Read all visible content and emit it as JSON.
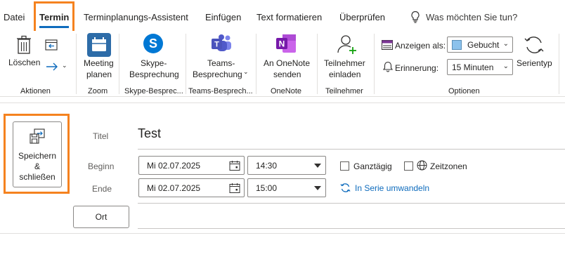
{
  "tabs": {
    "items": [
      "Datei",
      "Termin",
      "Terminplanungs-Assistent",
      "Einfügen",
      "Text formatieren",
      "Überprüfen"
    ],
    "search_placeholder": "Was möchten Sie tun?"
  },
  "ribbon": {
    "loeschen": "Löschen",
    "meeting_1": "Meeting",
    "meeting_2": "planen",
    "skype_1": "Skype-",
    "skype_2": "Besprechung",
    "teams_1": "Teams-",
    "teams_2": "Besprechung",
    "onenote_1": "An OneNote",
    "onenote_2": "senden",
    "teilnehmer_1": "Teilnehmer",
    "teilnehmer_2": "einladen",
    "anzeigen_als_label": "Anzeigen als:",
    "anzeigen_als_value": "Gebucht",
    "erinnerung_label": "Erinnerung:",
    "erinnerung_value": "15 Minuten",
    "serientyp": "Serientyp",
    "groups": {
      "aktionen": "Aktionen",
      "zoom": "Zoom",
      "skype": "Skype-Besprec...",
      "teams": "Teams-Besprech...",
      "onenote": "OneNote",
      "teilnehmer": "Teilnehmer",
      "optionen": "Optionen"
    }
  },
  "form": {
    "save_1": "Speichern",
    "save_2": "&",
    "save_3": "schließen",
    "titel_label": "Titel",
    "titel_value": "Test",
    "beginn_label": "Beginn",
    "beginn_date": "Mi 02.07.2025",
    "beginn_time": "14:30",
    "ende_label": "Ende",
    "ende_date": "Mi 02.07.2025",
    "ende_time": "15:00",
    "ganztaegig": "Ganztägig",
    "zeitzonen": "Zeitzonen",
    "serie_link": "In Serie umwandeln",
    "ort_button": "Ort"
  },
  "colors": {
    "accent": "#0f6cbd",
    "highlight": "#f5821f",
    "status_busy": "#8cc2ec"
  }
}
